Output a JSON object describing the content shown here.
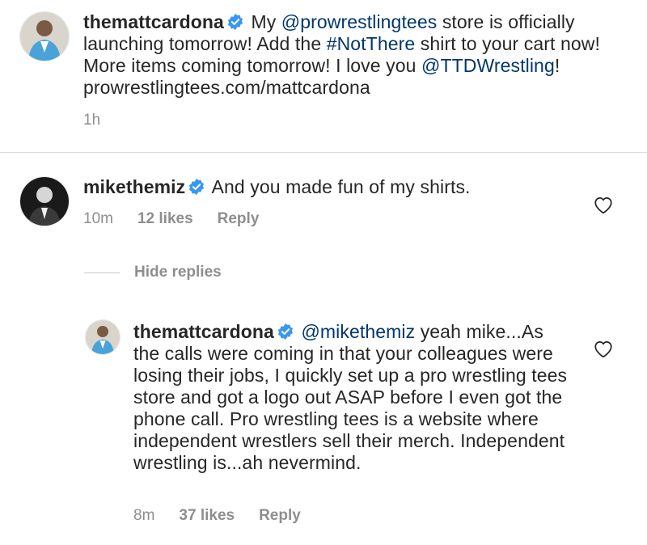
{
  "caption": {
    "username": "themattcardona",
    "text_parts": [
      "My ",
      "@prowrestlingtees",
      " store is officially launching tomorrow! Add the ",
      "#NotThere",
      " shirt to your cart now! More items coming tomorrow! I love you ",
      "@TTDWrestling",
      "! prowrestlingtees.com/mattcardona"
    ],
    "time": "1h"
  },
  "comment": {
    "username": "mikethemiz",
    "text": "And you made fun of my shirts.",
    "time": "10m",
    "likes": "12 likes",
    "reply": "Reply"
  },
  "hide_replies": "Hide replies",
  "reply": {
    "username": "themattcardona",
    "mention": "@mikethemiz",
    "text": " yeah mike...As the calls were coming in that your colleagues were losing their jobs, I quickly set up a pro wrestling tees store and got a logo out ASAP before I even got the phone call. Pro wrestling tees is a website where independent wrestlers sell their merch. Independent wrestling is...ah nevermind.",
    "time": "8m",
    "likes": "37 likes",
    "reply": "Reply"
  },
  "colors": {
    "verified": "#3897f0",
    "link": "#00376b",
    "muted": "#8e8e8e"
  },
  "icons": [
    "verified-badge-icon",
    "heart-icon"
  ]
}
